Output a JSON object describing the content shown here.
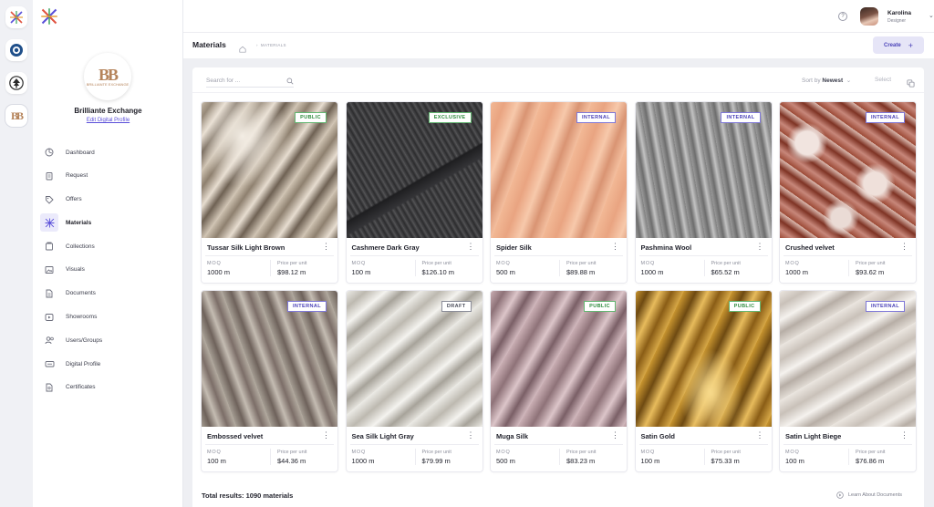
{
  "app": {
    "name": "Brilliante Exchange"
  },
  "rail": {
    "items": [
      "brand-x-icon",
      "rounded-badge-icon",
      "tree-seal-icon",
      "bb-logo-icon"
    ]
  },
  "sidebar": {
    "org_name": "Brilliante Exchange",
    "edit_link": "Edit Digital Profile",
    "logo_text": "BB",
    "logo_caption": "BRILLIANTE EXCHANGE",
    "items": [
      {
        "label": "Dashboard",
        "icon": "dashboard-icon"
      },
      {
        "label": "Request",
        "icon": "clipboard-icon"
      },
      {
        "label": "Offers",
        "icon": "tag-icon"
      },
      {
        "label": "Materials",
        "icon": "materials-icon",
        "active": true
      },
      {
        "label": "Collections",
        "icon": "collections-icon"
      },
      {
        "label": "Visuals",
        "icon": "image-icon"
      },
      {
        "label": "Documents",
        "icon": "document-icon"
      },
      {
        "label": "Showrooms",
        "icon": "play-icon"
      },
      {
        "label": "Users/Groups",
        "icon": "users-icon"
      },
      {
        "label": "Digital Profile",
        "icon": "id-card-icon"
      },
      {
        "label": "Certificates",
        "icon": "certificate-icon"
      }
    ]
  },
  "topbar": {
    "user_name": "Karolina",
    "user_role": "Designer",
    "help": "?"
  },
  "header": {
    "title": "Materials",
    "breadcrumb": "MATERIALS",
    "create_label": "Create"
  },
  "toolbar": {
    "search_placeholder": "Search for ...",
    "sort_prefix": "Sort by",
    "sort_value": "Newest",
    "select_label": "Select"
  },
  "materials": [
    {
      "name": "Tussar Silk Light Brown",
      "badge": "PUBLIC",
      "moq_label": "MOQ",
      "moq": "1000 m",
      "price_label": "Price per unit",
      "price": "$98.12 m"
    },
    {
      "name": "Cashmere Dark Gray",
      "badge": "EXCLUSIVE",
      "moq_label": "MOQ",
      "moq": "100 m",
      "price_label": "Price per unit",
      "price": "$126.10 m"
    },
    {
      "name": "Spider Silk",
      "badge": "INTERNAL",
      "moq_label": "MOQ",
      "moq": "500 m",
      "price_label": "Price per unit",
      "price": "$89.88 m"
    },
    {
      "name": "Pashmina Wool",
      "badge": "INTERNAL",
      "moq_label": "MOQ",
      "moq": "1000 m",
      "price_label": "Price per unit",
      "price": "$65.52 m"
    },
    {
      "name": "Crushed velvet",
      "badge": "INTERNAL",
      "moq_label": "MOQ",
      "moq": "1000 m",
      "price_label": "Price per unit",
      "price": "$93.62 m"
    },
    {
      "name": "Embossed velvet",
      "badge": "INTERNAL",
      "moq_label": "MOQ",
      "moq": "100 m",
      "price_label": "Price per unit",
      "price": "$44.36 m"
    },
    {
      "name": "Sea Silk Light Gray",
      "badge": "DRAFT",
      "moq_label": "MOQ",
      "moq": "1000 m",
      "price_label": "Price per unit",
      "price": "$79.99 m"
    },
    {
      "name": "Muga Silk",
      "badge": "PUBLIC",
      "moq_label": "MOQ",
      "moq": "500 m",
      "price_label": "Price per unit",
      "price": "$83.23 m"
    },
    {
      "name": "Satin Gold",
      "badge": "PUBLIC",
      "moq_label": "MOQ",
      "moq": "100 m",
      "price_label": "Price per unit",
      "price": "$75.33 m"
    },
    {
      "name": "Satin Light Biege",
      "badge": "INTERNAL",
      "moq_label": "MOQ",
      "moq": "100 m",
      "price_label": "Price per unit",
      "price": "$76.86 m"
    }
  ],
  "footer": {
    "total": "Total results: 1090 materials",
    "learn_link": "Learn About Documents"
  },
  "colors": {
    "accent": "#4b42b8",
    "public": "#2e8b3d",
    "background": "#eeeff3"
  }
}
